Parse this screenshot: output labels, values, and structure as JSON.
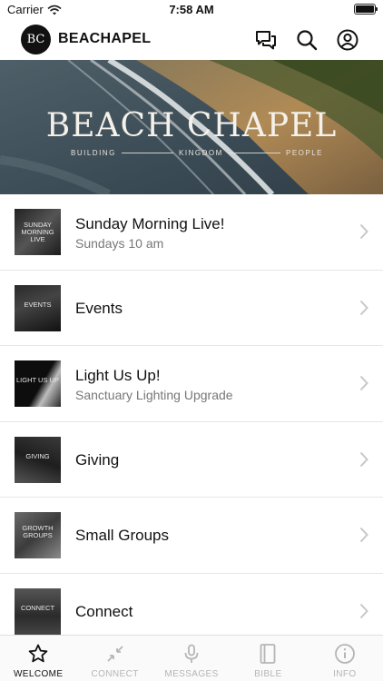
{
  "status_bar": {
    "carrier": "Carrier",
    "time": "7:58 AM"
  },
  "header": {
    "logo_text": "BC",
    "title": "BEACHAPEL",
    "icons": [
      "chat-bubbles-icon",
      "search-icon",
      "account-icon"
    ]
  },
  "hero": {
    "title": "BEACH CHAPEL",
    "subtitle_words": [
      "BUILDING",
      "KINGDOM",
      "PEOPLE"
    ]
  },
  "list": [
    {
      "thumb_label": "SUNDAY MORNING LIVE",
      "title": "Sunday Morning Live!",
      "subtitle": "Sundays 10 am"
    },
    {
      "thumb_label": "EVENTS",
      "title": "Events",
      "subtitle": ""
    },
    {
      "thumb_label": "LIGHT US UP",
      "title": "Light Us Up!",
      "subtitle": "Sanctuary Lighting Upgrade"
    },
    {
      "thumb_label": "GIVING",
      "title": "Giving",
      "subtitle": ""
    },
    {
      "thumb_label": "GROWTH GROUPS",
      "title": "Small Groups",
      "subtitle": ""
    },
    {
      "thumb_label": "CONNECT",
      "title": "Connect",
      "subtitle": ""
    }
  ],
  "tabs": [
    {
      "label": "WELCOME",
      "icon": "star-icon",
      "active": true
    },
    {
      "label": "CONNECT",
      "icon": "arrows-icon",
      "active": false
    },
    {
      "label": "MESSAGES",
      "icon": "microphone-icon",
      "active": false
    },
    {
      "label": "BIBLE",
      "icon": "book-icon",
      "active": false
    },
    {
      "label": "INFO",
      "icon": "info-icon",
      "active": false
    }
  ],
  "colors": {
    "tab_active": "#111111",
    "tab_inactive": "#b5b5b5",
    "subtitle": "#777777"
  }
}
